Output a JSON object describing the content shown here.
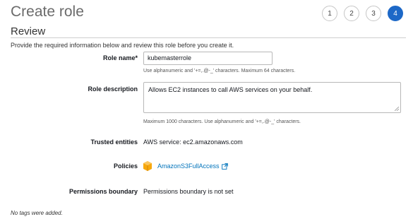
{
  "page": {
    "title": "Create role",
    "steps": [
      "1",
      "2",
      "3",
      "4"
    ],
    "active_step": "4"
  },
  "review": {
    "section_title": "Review",
    "intro": "Provide the required information below and review this role before you create it.",
    "role_name_label": "Role name*",
    "role_name_value": "kubemasterrole",
    "role_name_hint": "Use alphanumeric and '+=,.@-_' characters. Maximum 64 characters.",
    "role_description_label": "Role description",
    "role_description_value": "Allows EC2 instances to call AWS services on your behalf.",
    "role_description_hint": "Maximum 1000 characters. Use alphanumeric and '+=,.@-_' characters.",
    "trusted_entities_label": "Trusted entities",
    "trusted_entities_value": "AWS service: ec2.amazonaws.com",
    "policies_label": "Policies",
    "policy_name": "AmazonS3FullAccess",
    "permissions_boundary_label": "Permissions boundary",
    "permissions_boundary_value": "Permissions boundary is not set",
    "tags_note": "No tags were added."
  },
  "colors": {
    "accent": "#1d68c7",
    "link": "#0073bb",
    "policy_icon": "#f7a80d"
  },
  "icons": {
    "policy": "aws-managed-policy-icon",
    "external": "external-link-icon"
  }
}
